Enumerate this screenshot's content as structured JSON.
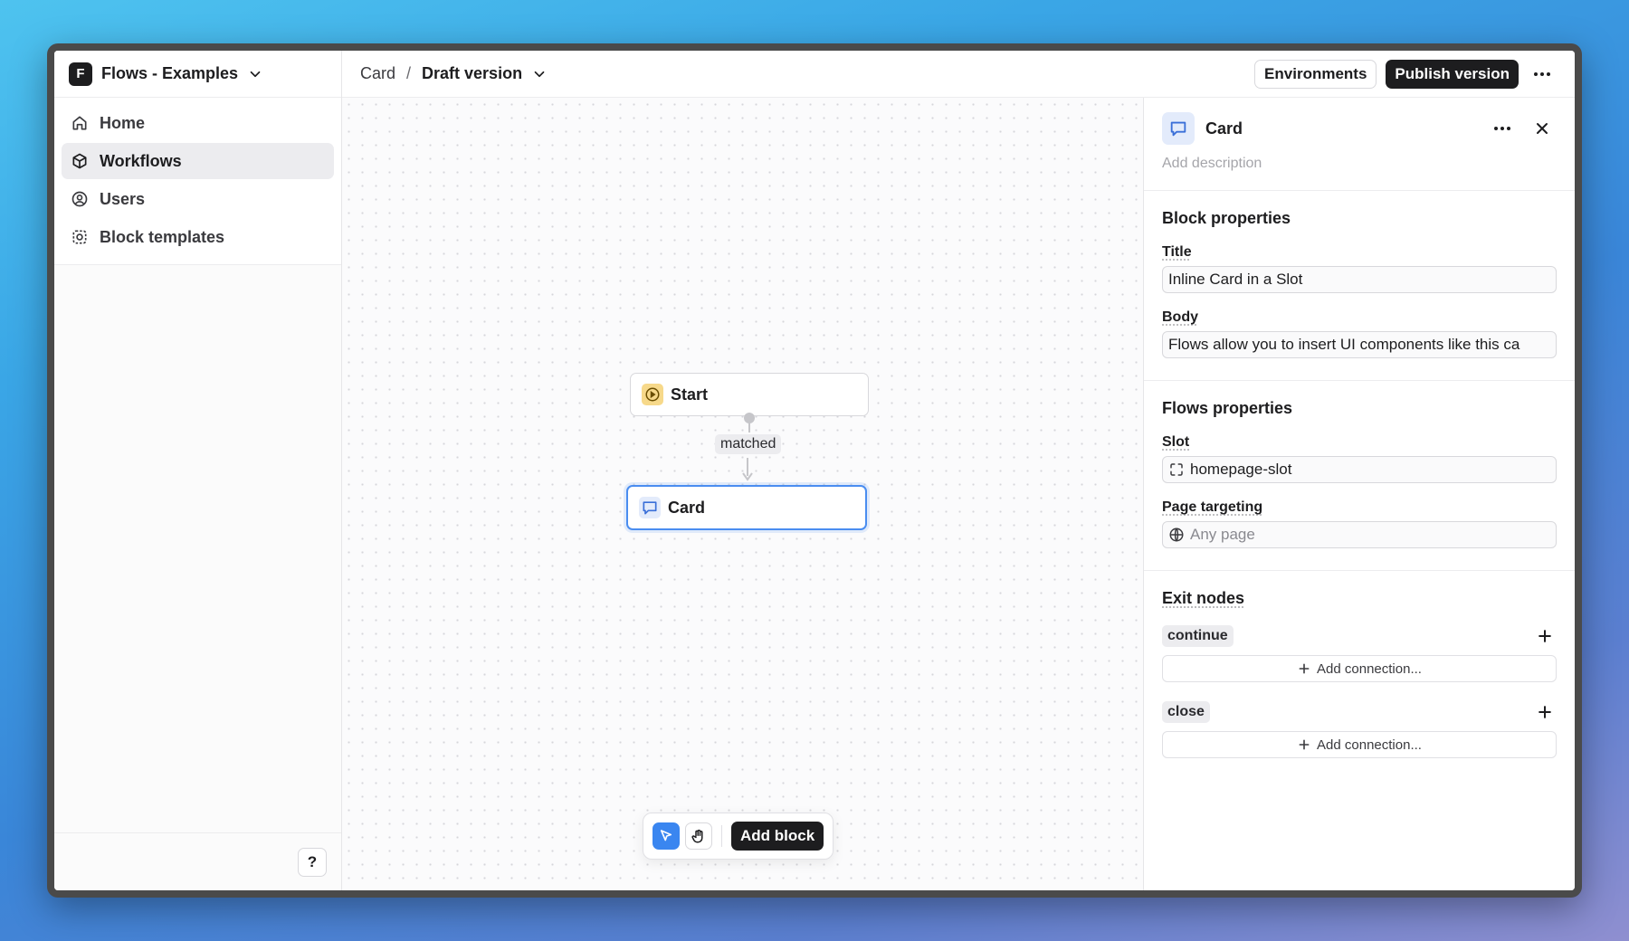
{
  "workspace": {
    "logo_letter": "F",
    "name": "Flows - Examples"
  },
  "sidebar": {
    "items": [
      {
        "label": "Home",
        "icon": "home-icon"
      },
      {
        "label": "Workflows",
        "icon": "cube-icon",
        "active": true
      },
      {
        "label": "Users",
        "icon": "user-circle-icon"
      },
      {
        "label": "Block templates",
        "icon": "template-icon"
      }
    ],
    "help_label": "?"
  },
  "topbar": {
    "breadcrumb_root": "Card",
    "separator": "/",
    "breadcrumb_current": "Draft version",
    "environments_label": "Environments",
    "publish_label": "Publish version"
  },
  "canvas": {
    "start_node": {
      "label": "Start"
    },
    "edge_label": "matched",
    "card_node": {
      "label": "Card"
    },
    "toolbar": {
      "add_block_label": "Add block"
    }
  },
  "panel": {
    "title": "Card",
    "description_placeholder": "Add description",
    "block_properties": {
      "heading": "Block properties",
      "title_label": "Title",
      "title_value": "Inline Card in a Slot",
      "body_label": "Body",
      "body_value": "Flows allow you to insert UI components like this ca"
    },
    "flows_properties": {
      "heading": "Flows properties",
      "slot_label": "Slot",
      "slot_value": "homepage-slot",
      "page_targeting_label": "Page targeting",
      "page_targeting_placeholder": "Any page"
    },
    "exit_nodes": {
      "heading": "Exit nodes",
      "items": [
        {
          "name": "continue",
          "add_label": "Add connection..."
        },
        {
          "name": "close",
          "add_label": "Add connection..."
        }
      ]
    }
  },
  "colors": {
    "accent": "#3a86f0",
    "dark": "#1d1d1f",
    "start_icon_bg": "#f7d98a",
    "card_icon_bg": "#e3ebfb"
  }
}
